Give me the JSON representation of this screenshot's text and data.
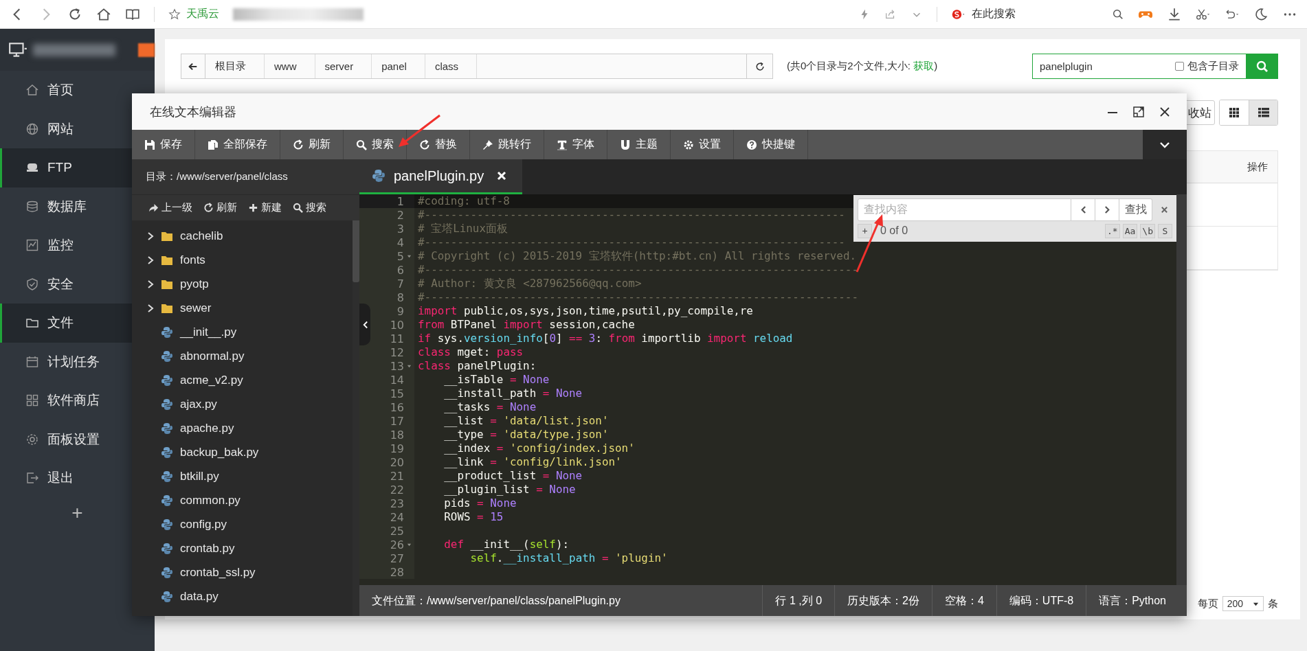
{
  "browser": {
    "site_name": "天禹云",
    "search_label": "在此搜索"
  },
  "sidebar": {
    "items": [
      {
        "label": "首页",
        "selected": false
      },
      {
        "label": "网站",
        "selected": false
      },
      {
        "label": "FTP",
        "selected": true
      },
      {
        "label": "数据库",
        "selected": false
      },
      {
        "label": "监控",
        "selected": false
      },
      {
        "label": "安全",
        "selected": false
      },
      {
        "label": "文件",
        "selected": true
      },
      {
        "label": "计划任务",
        "selected": false
      },
      {
        "label": "软件商店",
        "selected": false
      },
      {
        "label": "面板设置",
        "selected": false
      },
      {
        "label": "退出",
        "selected": false
      }
    ],
    "add_button": "+"
  },
  "file_manager": {
    "breadcrumb": [
      "根目录",
      "www",
      "server",
      "panel",
      "class"
    ],
    "summary_start": "(共0个目录与2个文件,大小: ",
    "summary_link": "获取",
    "summary_end": ")",
    "search": {
      "value": "panelplugin",
      "checkbox_label": "包含子目录",
      "checked": false
    },
    "recycle_button": "收站",
    "view_modes": [
      {
        "selected": false
      },
      {
        "selected": true
      }
    ],
    "table": {
      "columns": [
        "操作"
      ]
    },
    "pagination": {
      "per_page_label": "每页",
      "per_page": "200",
      "unit": "条"
    }
  },
  "editor": {
    "title": "在线文本编辑器",
    "toolbar": [
      "保存",
      "全部保存",
      "刷新",
      "搜索",
      "替换",
      "跳转行",
      "字体",
      "主题",
      "设置",
      "快捷键"
    ],
    "directory": "目录：/www/server/panel/class",
    "tree_toolbar": [
      "上一级",
      "刷新",
      "新建",
      "搜索"
    ],
    "files": [
      {
        "name": "cachelib",
        "kind": "folder"
      },
      {
        "name": "fonts",
        "kind": "folder"
      },
      {
        "name": "pyotp",
        "kind": "folder"
      },
      {
        "name": "sewer",
        "kind": "folder"
      },
      {
        "name": "__init__.py",
        "kind": "file"
      },
      {
        "name": "abnormal.py",
        "kind": "file"
      },
      {
        "name": "acme_v2.py",
        "kind": "file"
      },
      {
        "name": "ajax.py",
        "kind": "file"
      },
      {
        "name": "apache.py",
        "kind": "file"
      },
      {
        "name": "backup_bak.py",
        "kind": "file"
      },
      {
        "name": "btkill.py",
        "kind": "file"
      },
      {
        "name": "common.py",
        "kind": "file"
      },
      {
        "name": "config.py",
        "kind": "file"
      },
      {
        "name": "crontab.py",
        "kind": "file"
      },
      {
        "name": "crontab_ssl.py",
        "kind": "file"
      },
      {
        "name": "data.py",
        "kind": "file"
      }
    ],
    "tabs": [
      {
        "label": "panelPlugin.py",
        "selected": true
      }
    ],
    "lines": [
      {
        "number": "1",
        "active": true,
        "fold": false,
        "tokens": [
          {
            "kind": "comment",
            "text": "#coding: utf-8"
          }
        ]
      },
      {
        "number": "2",
        "active": false,
        "fold": false,
        "tokens": [
          {
            "kind": "comment",
            "text": "#----------------------------------------------------------------"
          }
        ]
      },
      {
        "number": "3",
        "active": false,
        "fold": false,
        "tokens": [
          {
            "kind": "comment",
            "text": "# 宝塔Linux面板"
          }
        ]
      },
      {
        "number": "4",
        "active": false,
        "fold": false,
        "tokens": [
          {
            "kind": "comment",
            "text": "#----------------------------------------------------------------"
          }
        ]
      },
      {
        "number": "5",
        "active": false,
        "fold": true,
        "tokens": [
          {
            "kind": "comment",
            "text": "# Copyright (c) 2015-2019 宝塔软件(http:#bt.cn) All rights reserved."
          }
        ]
      },
      {
        "number": "6",
        "active": false,
        "fold": false,
        "tokens": [
          {
            "kind": "comment",
            "text": "#------------------------------------------------------------------"
          }
        ]
      },
      {
        "number": "7",
        "active": false,
        "fold": false,
        "tokens": [
          {
            "kind": "comment",
            "text": "# Author: 黄文良 <287962566@qq.com>"
          }
        ]
      },
      {
        "number": "8",
        "active": false,
        "fold": false,
        "tokens": [
          {
            "kind": "comment",
            "text": "#------------------------------------------------------------------"
          }
        ]
      },
      {
        "number": "9",
        "active": false,
        "fold": false,
        "tokens": [
          {
            "kind": "keyword",
            "text": "import"
          },
          {
            "kind": "plain",
            "text": " public,os,sys,json,time,psutil,py_compile,re"
          }
        ]
      },
      {
        "number": "10",
        "active": false,
        "fold": false,
        "tokens": [
          {
            "kind": "keyword",
            "text": "from"
          },
          {
            "kind": "plain",
            "text": " BTPanel "
          },
          {
            "kind": "keyword",
            "text": "import"
          },
          {
            "kind": "plain",
            "text": " session,cache"
          }
        ]
      },
      {
        "number": "11",
        "active": false,
        "fold": false,
        "tokens": [
          {
            "kind": "keyword",
            "text": "if"
          },
          {
            "kind": "plain",
            "text": " sys."
          },
          {
            "kind": "builtin",
            "text": "version_info"
          },
          {
            "kind": "plain",
            "text": "["
          },
          {
            "kind": "number",
            "text": "0"
          },
          {
            "kind": "plain",
            "text": "] "
          },
          {
            "kind": "keyword",
            "text": "== "
          },
          {
            "kind": "number",
            "text": "3"
          },
          {
            "kind": "plain",
            "text": ": "
          },
          {
            "kind": "keyword",
            "text": "from"
          },
          {
            "kind": "plain",
            "text": " importlib "
          },
          {
            "kind": "keyword",
            "text": "import "
          },
          {
            "kind": "builtin",
            "text": "reload"
          }
        ]
      },
      {
        "number": "12",
        "active": false,
        "fold": false,
        "tokens": [
          {
            "kind": "keyword",
            "text": "class"
          },
          {
            "kind": "plain",
            "text": " mget: "
          },
          {
            "kind": "keyword",
            "text": "pass"
          }
        ]
      },
      {
        "number": "13",
        "active": false,
        "fold": true,
        "tokens": [
          {
            "kind": "keyword",
            "text": "class"
          },
          {
            "kind": "plain",
            "text": " panelPlugin:"
          }
        ]
      },
      {
        "number": "14",
        "active": false,
        "fold": false,
        "tokens": [
          {
            "kind": "plain",
            "text": "    __isTable "
          },
          {
            "kind": "keyword",
            "text": "= "
          },
          {
            "kind": "number",
            "text": "None"
          }
        ]
      },
      {
        "number": "15",
        "active": false,
        "fold": false,
        "tokens": [
          {
            "kind": "plain",
            "text": "    __install_path "
          },
          {
            "kind": "keyword",
            "text": "= "
          },
          {
            "kind": "number",
            "text": "None"
          }
        ]
      },
      {
        "number": "16",
        "active": false,
        "fold": false,
        "tokens": [
          {
            "kind": "plain",
            "text": "    __tasks "
          },
          {
            "kind": "keyword",
            "text": "= "
          },
          {
            "kind": "number",
            "text": "None"
          }
        ]
      },
      {
        "number": "17",
        "active": false,
        "fold": false,
        "tokens": [
          {
            "kind": "plain",
            "text": "    __list "
          },
          {
            "kind": "keyword",
            "text": "= "
          },
          {
            "kind": "string",
            "text": "'data/list.json'"
          }
        ]
      },
      {
        "number": "18",
        "active": false,
        "fold": false,
        "tokens": [
          {
            "kind": "plain",
            "text": "    __type "
          },
          {
            "kind": "keyword",
            "text": "= "
          },
          {
            "kind": "string",
            "text": "'data/type.json'"
          }
        ]
      },
      {
        "number": "19",
        "active": false,
        "fold": false,
        "tokens": [
          {
            "kind": "plain",
            "text": "    __index "
          },
          {
            "kind": "keyword",
            "text": "= "
          },
          {
            "kind": "string",
            "text": "'config/index.json'"
          }
        ]
      },
      {
        "number": "20",
        "active": false,
        "fold": false,
        "tokens": [
          {
            "kind": "plain",
            "text": "    __link "
          },
          {
            "kind": "keyword",
            "text": "= "
          },
          {
            "kind": "string",
            "text": "'config/link.json'"
          }
        ]
      },
      {
        "number": "21",
        "active": false,
        "fold": false,
        "tokens": [
          {
            "kind": "plain",
            "text": "    __product_list "
          },
          {
            "kind": "keyword",
            "text": "= "
          },
          {
            "kind": "number",
            "text": "None"
          }
        ]
      },
      {
        "number": "22",
        "active": false,
        "fold": false,
        "tokens": [
          {
            "kind": "plain",
            "text": "    __plugin_list "
          },
          {
            "kind": "keyword",
            "text": "= "
          },
          {
            "kind": "number",
            "text": "None"
          }
        ]
      },
      {
        "number": "23",
        "active": false,
        "fold": false,
        "tokens": [
          {
            "kind": "plain",
            "text": "    pids "
          },
          {
            "kind": "keyword",
            "text": "= "
          },
          {
            "kind": "number",
            "text": "None"
          }
        ]
      },
      {
        "number": "24",
        "active": false,
        "fold": false,
        "tokens": [
          {
            "kind": "plain",
            "text": "    ROWS "
          },
          {
            "kind": "keyword",
            "text": "= "
          },
          {
            "kind": "number",
            "text": "15"
          }
        ]
      },
      {
        "number": "25",
        "active": false,
        "fold": false
      },
      {
        "number": "26",
        "active": false,
        "fold": true,
        "tokens": [
          {
            "kind": "keyword",
            "text": "    def"
          },
          {
            "kind": "plain",
            "text": " __init__("
          },
          {
            "kind": "param",
            "text": "self"
          },
          {
            "kind": "plain",
            "text": "):"
          }
        ]
      },
      {
        "number": "27",
        "active": false,
        "fold": false,
        "tokens": [
          {
            "kind": "param",
            "text": "        self"
          },
          {
            "kind": "plain",
            "text": "."
          },
          {
            "kind": "builtin",
            "text": "__install_path"
          },
          {
            "kind": "keyword",
            "text": " = "
          },
          {
            "kind": "string",
            "text": "'plugin'"
          }
        ]
      },
      {
        "number": "28",
        "active": false,
        "fold": false
      }
    ],
    "find": {
      "placeholder": "查找内容",
      "button": "查找",
      "add": "+",
      "count": "0 of 0",
      "options": [
        {
          "label": ".*",
          "selected": false
        },
        {
          "label": "Aa",
          "selected": false
        },
        {
          "label": "\\b",
          "selected": false
        },
        {
          "label": "S",
          "selected": false
        }
      ]
    },
    "status": [
      "文件位置：/www/server/panel/class/panelPlugin.py",
      "行 1 ,列 0",
      "历史版本：2份",
      "空格：4",
      "编码：UTF-8",
      "语言：Python"
    ]
  }
}
